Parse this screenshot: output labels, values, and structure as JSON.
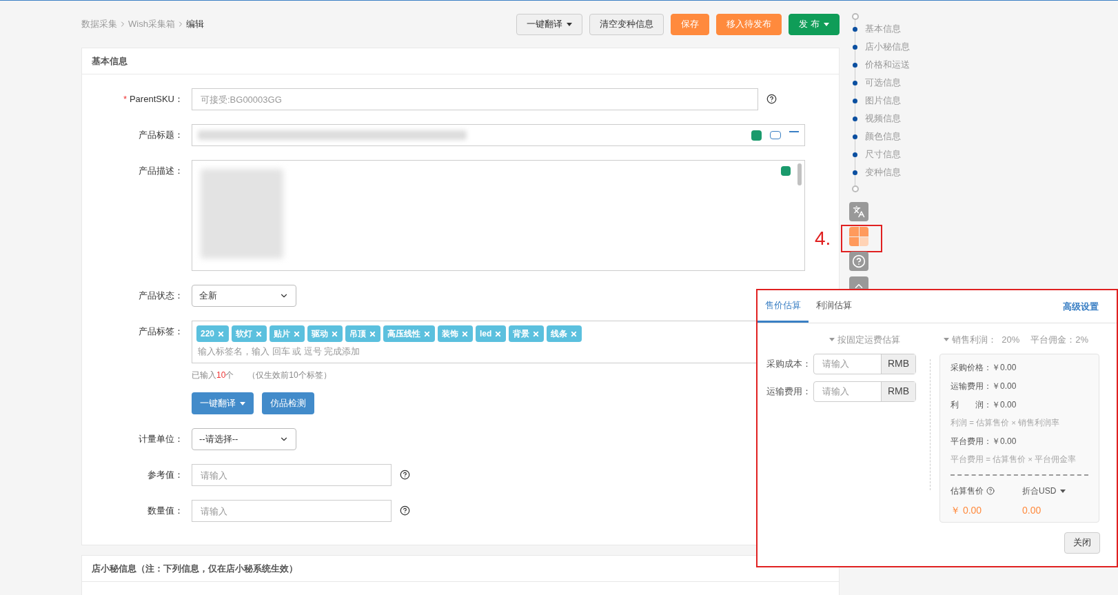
{
  "breadcrumb": [
    {
      "label": "数据采集",
      "current": false
    },
    {
      "label": "Wish采集箱",
      "current": false
    },
    {
      "label": "编辑",
      "current": true
    }
  ],
  "toolbar": [
    {
      "label": "一键翻译",
      "kind": "default",
      "caret": true
    },
    {
      "label": "清空变种信息",
      "kind": "default",
      "caret": false
    },
    {
      "label": "保存",
      "kind": "orange",
      "caret": false
    },
    {
      "label": "移入待发布",
      "kind": "orange",
      "caret": false
    },
    {
      "label": "发 布",
      "kind": "green",
      "caret": true
    }
  ],
  "section": {
    "title": "基本信息"
  },
  "fields": [
    {
      "kind": "sku",
      "label": "ParentSKU：",
      "required_mark": "*",
      "placeholder": "可接受:BG00003GG"
    },
    {
      "kind": "title",
      "label": "产品标题："
    },
    {
      "kind": "description",
      "label": "产品描述："
    },
    {
      "kind": "select",
      "label": "产品状态：",
      "value": "全新"
    },
    {
      "kind": "tags",
      "label": "产品标签：",
      "tags": [
        "220",
        "软灯",
        "贴片",
        "驱动",
        "吊顶",
        "高压线性",
        "装饰",
        "led",
        "背景",
        "线条"
      ],
      "placeholder": "输入标签名，输入 回车 或 逗号 完成添加",
      "count_prefix": "已输入",
      "count": "10",
      "count_suffix": "个",
      "note": "（仅生效前10个标签）",
      "buttons": [
        {
          "label": "一键翻译",
          "caret": true
        },
        {
          "label": "仿品检测",
          "caret": false
        }
      ]
    },
    {
      "kind": "select",
      "label": "计量单位：",
      "value": "--请选择--"
    },
    {
      "kind": "text",
      "label": "参考值：",
      "placeholder": "请输入"
    },
    {
      "kind": "text",
      "label": "数量值：",
      "placeholder": "请输入"
    }
  ],
  "section2": {
    "title": "店小秘信息（注：下列信息，仅在店小秘系统生效）"
  },
  "nav": {
    "items": [
      "基本信息",
      "店小秘信息",
      "价格和运送",
      "可选信息",
      "图片信息",
      "视频信息",
      "颜色信息",
      "尺寸信息",
      "变种信息"
    ]
  },
  "tools": [
    {
      "kind": "translate"
    },
    {
      "kind": "calculator",
      "annotation": "4."
    },
    {
      "kind": "help"
    },
    {
      "kind": "top"
    }
  ],
  "popup": {
    "tabs": [
      {
        "label": "售价估算",
        "selected": true
      },
      {
        "label": "利润估算",
        "selected": false
      }
    ],
    "link": "高级设置",
    "mode": "按固定运费估算",
    "rates": [
      "销售利润：  20%",
      "平台佣金：2%"
    ],
    "inputs": [
      {
        "label": "采购成本：",
        "placeholder": "请输入",
        "unit": "RMB"
      },
      {
        "label": "运输费用：",
        "placeholder": "请输入",
        "unit": "RMB"
      }
    ],
    "summary": [
      {
        "kind": "value",
        "text": "采购价格：￥0.00"
      },
      {
        "kind": "value",
        "text": "运输费用：￥0.00"
      },
      {
        "kind": "value",
        "text": "利　　润：￥0.00"
      },
      {
        "kind": "formula",
        "text": "利润 = 估算售价 × 销售利润率"
      },
      {
        "kind": "value",
        "text": "平台费用：￥0.00"
      },
      {
        "kind": "formula",
        "text": "平台费用 = 估算售价 × 平台佣金率"
      }
    ],
    "result_label": "估算售价",
    "currency_label": "折合USD",
    "price": "￥ 0.00",
    "price_usd": "0.00",
    "close": "关闭"
  }
}
